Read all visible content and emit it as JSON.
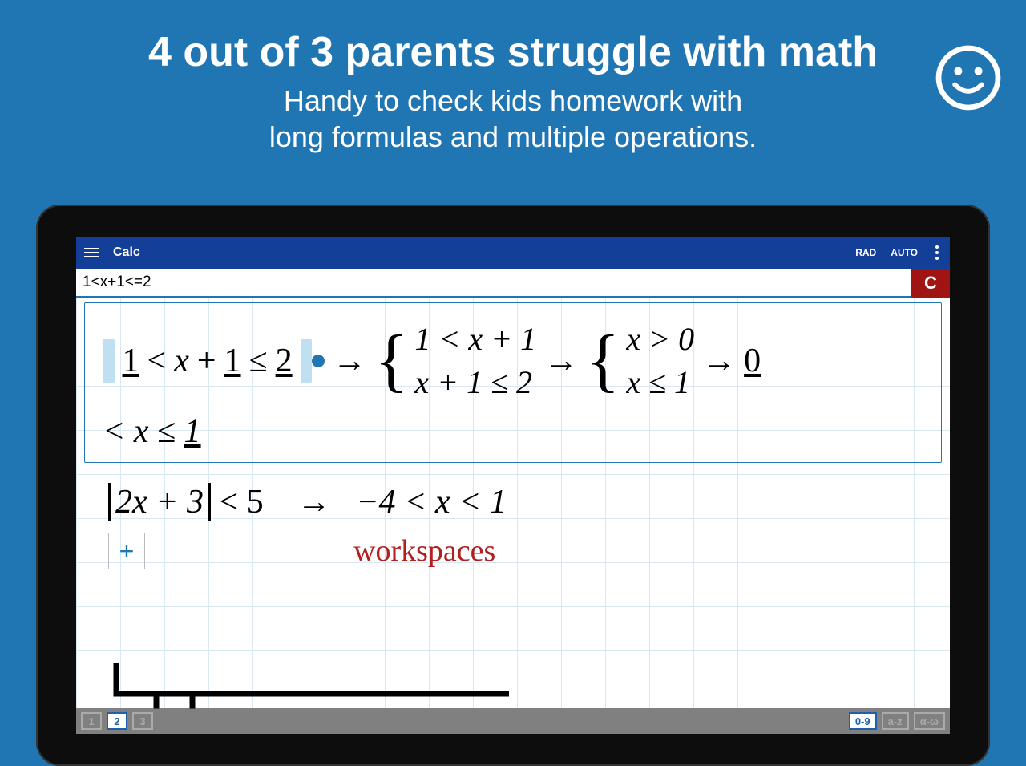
{
  "promo": {
    "headline": "4 out of 3 parents struggle with math",
    "sub1": "Handy to check kids homework with",
    "sub2": "long formulas and multiple operations."
  },
  "appbar": {
    "title": "Calc",
    "angle_mode": "RAD",
    "auto_mode": "AUTO"
  },
  "input": {
    "expression": "1<x+1<=2",
    "clear": "C"
  },
  "solution": {
    "input_pretty_1": "1",
    "input_pretty_lt": "<",
    "input_pretty_x": "x",
    "input_pretty_plus": "+",
    "input_pretty_1b": "1",
    "input_pretty_le": "≤",
    "input_pretty_2": "2",
    "arrow": "→",
    "sys1_line1": "1 < x + 1",
    "sys1_line2": "x + 1 ≤ 2",
    "sys2_line1": "x > 0",
    "sys2_line2": "x ≤ 1",
    "final_zero": "0",
    "final_tail": "< x ≤ 1"
  },
  "row2": {
    "abs_inner": "2x + 3",
    "rel": "< 5",
    "arrow": "→",
    "result": "−4 < x < 1"
  },
  "addrow": {
    "plus": "+",
    "label": "workspaces"
  },
  "tabs": {
    "ws": [
      "1",
      "2",
      "3"
    ],
    "active_ws_index": 1,
    "kbd": [
      "0-9",
      "a-z",
      "α-ω"
    ],
    "active_kbd_index": 0
  }
}
